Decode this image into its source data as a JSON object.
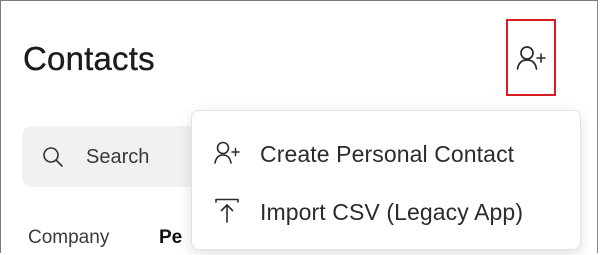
{
  "header": {
    "title": "Contacts",
    "add_contact_button": {
      "icon": "add-person-icon",
      "highlight_color": "#d81b24"
    }
  },
  "search": {
    "placeholder": "Search",
    "icon": "search-icon"
  },
  "tabs": [
    {
      "label": "Company"
    },
    {
      "label": "Pe"
    }
  ],
  "dropdown": {
    "items": [
      {
        "label": "Create Personal Contact",
        "icon": "add-person-icon"
      },
      {
        "label": "Import CSV (Legacy App)",
        "icon": "upload-icon"
      }
    ]
  }
}
